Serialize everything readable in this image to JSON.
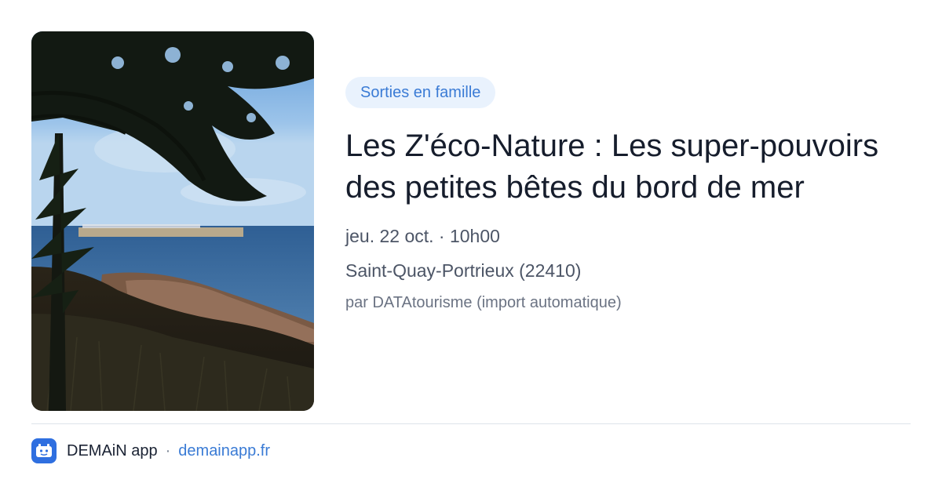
{
  "tag": "Sorties en famille",
  "title": "Les Z'éco-Nature : Les super-pouvoirs des petites bêtes du bord de mer",
  "date": "jeu. 22 oct. · 10h00",
  "location": "Saint-Quay-Portrieux (22410)",
  "source": "par DATAtourisme (import automatique)",
  "footer": {
    "app_name": "DEMAiN app",
    "separator": "·",
    "site": "demainapp.fr"
  },
  "colors": {
    "accent": "#3a7bd5",
    "tag_bg": "#e9f2fd",
    "app_icon": "#2f6fe0"
  },
  "icons": {
    "app_logo": "demain-app-icon"
  }
}
